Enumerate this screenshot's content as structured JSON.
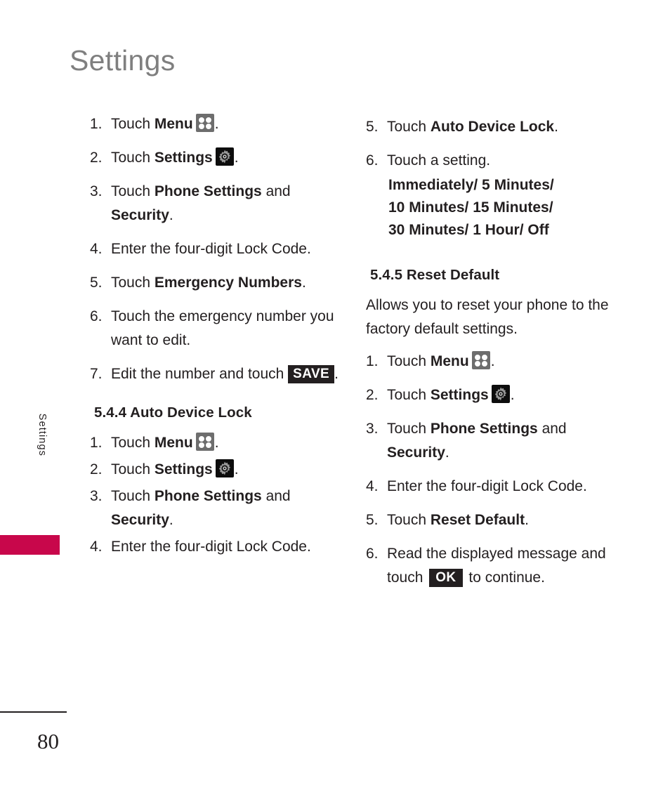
{
  "page": {
    "title": "Settings",
    "side_tab_label": "Settings",
    "page_number": "80",
    "accent_color": "#c8074b",
    "title_color": "#7f7f7f",
    "text_color": "#231f20"
  },
  "icons": {
    "menu": "menu-grid-icon",
    "settings": "gear-icon"
  },
  "keycaps": {
    "save": "SAVE",
    "ok": "OK"
  },
  "left_column": {
    "continued_steps": [
      {
        "num": "1.",
        "pre": "Touch ",
        "bold": "Menu",
        "icon": "menu",
        "post": "."
      },
      {
        "num": "2.",
        "pre": "Touch ",
        "bold": "Settings",
        "icon": "gear",
        "post": "."
      },
      {
        "num": "3.",
        "pre": "Touch ",
        "bold": "Phone Settings",
        "mid": " and ",
        "bold2": "Security",
        "post": "."
      },
      {
        "num": "4.",
        "pre": "Enter the four-digit Lock Code.",
        "post": ""
      },
      {
        "num": "5.",
        "pre": "Touch ",
        "bold": "Emergency Numbers",
        "post": "."
      },
      {
        "num": "6.",
        "pre": "Touch the emergency number you want to edit.",
        "post": ""
      },
      {
        "num": "7.",
        "pre": "Edit the number and touch ",
        "keycap": "save",
        "post": "."
      }
    ],
    "section": {
      "heading": "5.4.4 Auto Device Lock",
      "steps": [
        {
          "num": "1.",
          "pre": "Touch ",
          "bold": "Menu",
          "icon": "menu",
          "post": "."
        },
        {
          "num": "2.",
          "pre": "Touch ",
          "bold": "Settings",
          "icon": "gear",
          "post": "."
        },
        {
          "num": "3.",
          "pre": "Touch ",
          "bold": "Phone Settings",
          "mid": " and ",
          "bold2": "Security",
          "post": "."
        },
        {
          "num": "4.",
          "pre": "Enter the four-digit Lock Code.",
          "post": ""
        }
      ]
    }
  },
  "right_column": {
    "continued_steps": [
      {
        "num": "5.",
        "pre": "Touch ",
        "bold": "Auto Device Lock",
        "post": "."
      },
      {
        "num": "6.",
        "pre": "Touch a setting.",
        "post": ""
      }
    ],
    "options_lines": [
      "Immediately/ 5 Minutes/",
      "10 Minutes/ 15 Minutes/",
      "30 Minutes/ 1 Hour/ Off"
    ],
    "section": {
      "heading": "5.4.5 Reset Default",
      "description": "Allows you to reset your phone to the factory default settings.",
      "steps": [
        {
          "num": "1.",
          "pre": "Touch ",
          "bold": "Menu",
          "icon": "menu",
          "post": "."
        },
        {
          "num": "2.",
          "pre": "Touch ",
          "bold": "Settings",
          "icon": "gear",
          "post": "."
        },
        {
          "num": "3.",
          "pre": "Touch ",
          "bold": "Phone Settings",
          "mid": " and ",
          "bold2": "Security",
          "post": "."
        },
        {
          "num": "4.",
          "pre": "Enter the four-digit Lock Code.",
          "post": ""
        },
        {
          "num": "5.",
          "pre": "Touch ",
          "bold": "Reset Default",
          "post": "."
        },
        {
          "num": "6.",
          "pre": "Read the displayed message and touch ",
          "keycap": "ok",
          "post": " to continue."
        }
      ]
    }
  }
}
